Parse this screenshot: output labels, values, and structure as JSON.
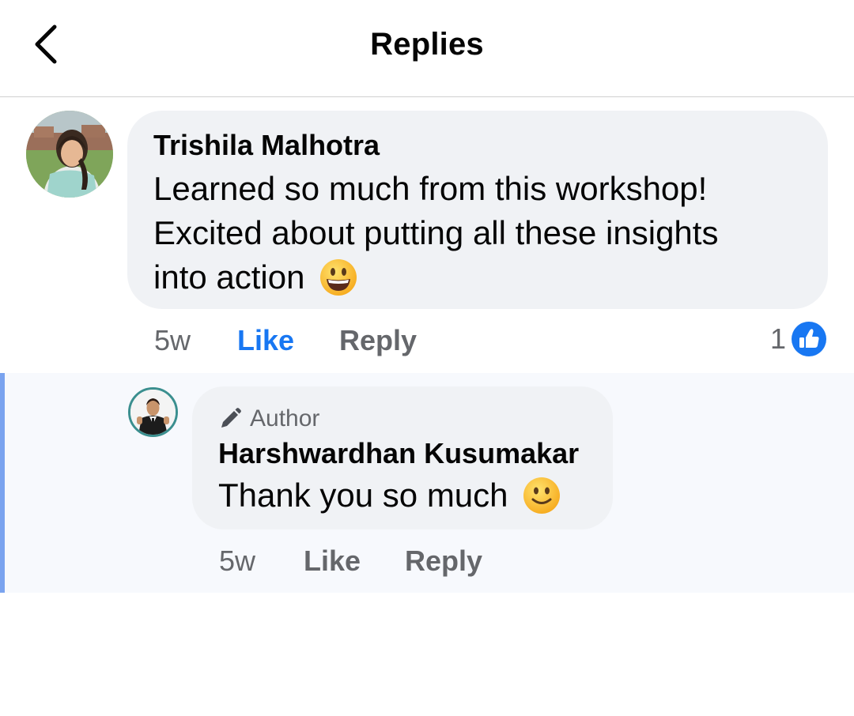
{
  "header": {
    "title": "Replies",
    "back_icon": "chevron-left-icon"
  },
  "comment": {
    "author": "Trishila Malhotra",
    "lines": [
      "Learned so much from this workshop!",
      "Excited about putting all these insights",
      "into action"
    ],
    "emoji": "grinning-face-emoji",
    "time": "5w",
    "like_label": "Like",
    "reply_label": "Reply",
    "reaction_count": "1",
    "reaction_icon": "thumbs-up-icon"
  },
  "reply": {
    "badge": "Author",
    "badge_icon": "pencil-icon",
    "author": "Harshwardhan Kusumakar",
    "text": "Thank you so much",
    "emoji": "slightly-smiling-face-emoji",
    "time": "5w",
    "like_label": "Like",
    "reply_label": "Reply"
  },
  "colors": {
    "accent": "#1877f2",
    "bubble": "#f0f2f5",
    "meta": "#65676b",
    "thread_bar": "#7aa3ef",
    "reply_bg": "#f7f9fd"
  }
}
